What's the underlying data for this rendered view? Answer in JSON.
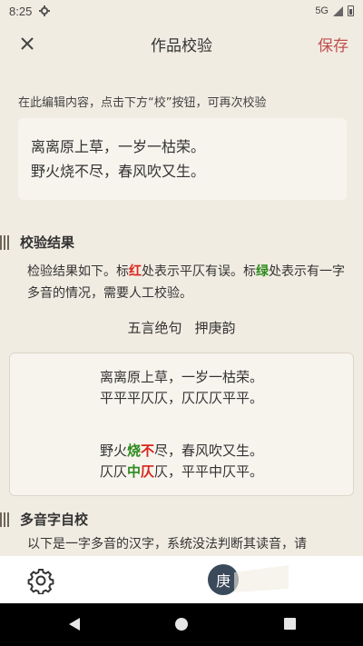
{
  "status_bar": {
    "time": "8:25",
    "network": "5G"
  },
  "app_bar": {
    "title": "作品校验",
    "save_label": "保存"
  },
  "edit": {
    "hint": "在此编辑内容，点击下方“校”按钮，可再次校验",
    "lines": [
      "离离原上草，一岁一枯荣。",
      "野火烧不尽，春风吹又生。"
    ]
  },
  "result": {
    "section_title": "校验结果",
    "desc_prefix": "检验结果如下。标",
    "desc_red": "红",
    "desc_middle": "处表示平仄有误。标",
    "desc_green": "绿",
    "desc_suffix": "处表示有一字多音的情况，需要人工校验。",
    "form": "五言绝句",
    "rhyme": "押庚韵",
    "line1": "离离原上草，一岁一枯荣。",
    "tone1": "平平平仄仄，仄仄仄平平。",
    "line2_a": "野火",
    "line2_green": "烧",
    "line2_red": "不",
    "line2_b": "尽，春风吹又生。",
    "tone2_a": "仄仄",
    "tone2_green": "中",
    "tone2_red": "仄",
    "tone2_b": "仄，平平中仄平。"
  },
  "polyphone": {
    "section_title": "多音字自校",
    "desc": "以下是一字多音的汉字，系统没法判断其读音，请"
  },
  "bottom_bar": {
    "badge": "庚"
  },
  "colors": {
    "accent": "#c0504d",
    "error": "#d9261c",
    "polyphone": "#2e8b1f",
    "badge": "#3a4a5a"
  }
}
